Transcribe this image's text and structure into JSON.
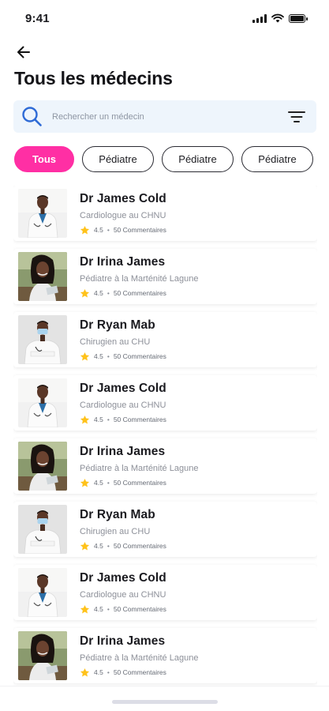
{
  "status_bar": {
    "time": "9:41"
  },
  "header": {
    "title": "Tous les médecins"
  },
  "search": {
    "placeholder": "Rechercher un médecin"
  },
  "filters": [
    "Tous",
    "Pédiatre",
    "Pédiatre",
    "Pédiatre"
  ],
  "active_filter": "Tous",
  "colors": {
    "accent": "#ff2fa4",
    "search_bg": "#eef5fc",
    "search_icon": "#2f6bd6",
    "star": "#ffc21a"
  },
  "doctors": [
    {
      "name": "Dr James Cold",
      "specialty": "Cardiologue au CHNU",
      "rating": "4.5",
      "comments": "50 Commentaires",
      "avatar": "doctor-a"
    },
    {
      "name": "Dr Irina James",
      "specialty": "Pédiatre à la Marténité Lagune",
      "rating": "4.5",
      "comments": "50 Commentaires",
      "avatar": "doctor-b"
    },
    {
      "name": "Dr Ryan Mab",
      "specialty": "Chirugien au CHU",
      "rating": "4.5",
      "comments": "50 Commentaires",
      "avatar": "doctor-c"
    },
    {
      "name": "Dr James Cold",
      "specialty": "Cardiologue au CHNU",
      "rating": "4.5",
      "comments": "50 Commentaires",
      "avatar": "doctor-a"
    },
    {
      "name": "Dr Irina James",
      "specialty": "Pédiatre à la Marténité Lagune",
      "rating": "4.5",
      "comments": "50 Commentaires",
      "avatar": "doctor-b"
    },
    {
      "name": "Dr Ryan Mab",
      "specialty": "Chirugien au CHU",
      "rating": "4.5",
      "comments": "50 Commentaires",
      "avatar": "doctor-c"
    },
    {
      "name": "Dr James Cold",
      "specialty": "Cardiologue au CHNU",
      "rating": "4.5",
      "comments": "50 Commentaires",
      "avatar": "doctor-a"
    },
    {
      "name": "Dr Irina James",
      "specialty": "Pédiatre à la Marténité Lagune",
      "rating": "4.5",
      "comments": "50 Commentaires",
      "avatar": "doctor-b"
    }
  ]
}
